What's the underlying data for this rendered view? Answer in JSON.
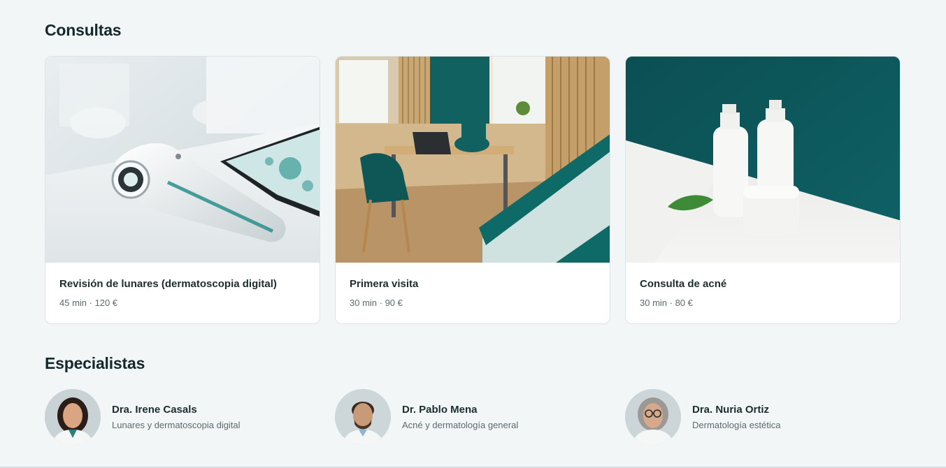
{
  "sections": {
    "consultas_title": "Consultas",
    "especialistas_title": "Especialistas"
  },
  "consultas": [
    {
      "title": "Revisión de lunares (dermatoscopia digital)",
      "meta": "45 min · 120 €",
      "image": "dermatoscope-photo"
    },
    {
      "title": "Primera visita",
      "meta": "30 min · 90 €",
      "image": "consultation-room-photo"
    },
    {
      "title": "Consulta de acné",
      "meta": "30 min · 80 €",
      "image": "skincare-bottles-photo"
    }
  ],
  "especialistas": [
    {
      "name": "Dra. Irene Casals",
      "specialty": "Lunares y dermatoscopia digital",
      "image": "doctor-portrait"
    },
    {
      "name": "Dr. Pablo Mena",
      "specialty": "Acné y dermatología general",
      "image": "doctor-portrait"
    },
    {
      "name": "Dra. Nuria Ortiz",
      "specialty": "Dermatología estética",
      "image": "doctor-portrait"
    }
  ],
  "colors": {
    "background": "#f3f6f7",
    "teal_accent": "#0f5f63",
    "heading": "#14292c",
    "muted_text": "#5b6a6d"
  }
}
